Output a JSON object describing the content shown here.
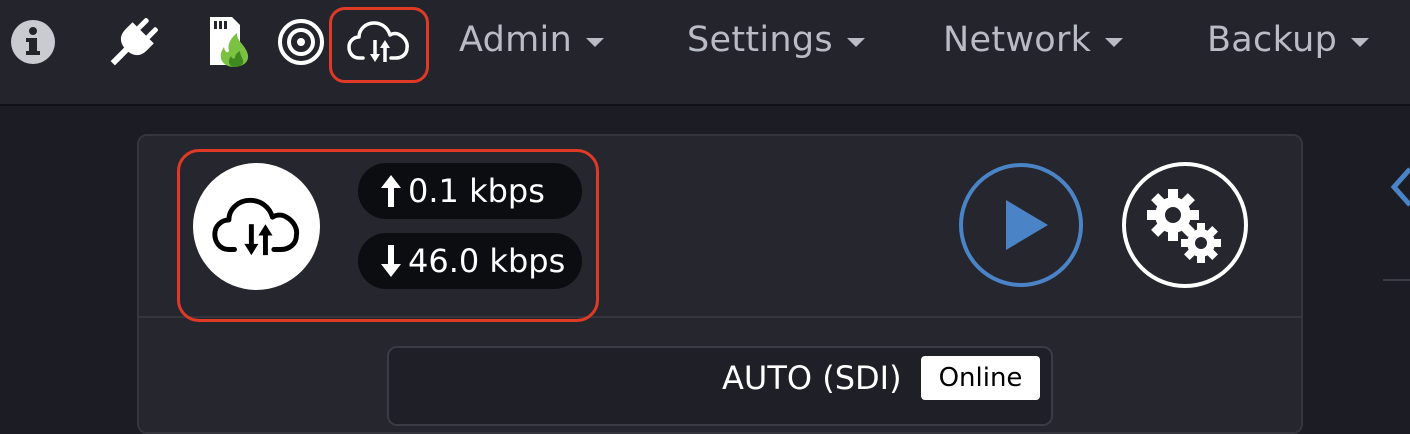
{
  "navbar": {
    "icons": [
      "info-icon",
      "plug-icon",
      "sd-card-fire-icon",
      "target-icon",
      "cloud-transfer-icon"
    ],
    "menus": [
      {
        "label": "Admin"
      },
      {
        "label": "Settings"
      },
      {
        "label": "Network"
      },
      {
        "label": "Backup"
      }
    ]
  },
  "stream": {
    "upload_rate": "0.1 kbps",
    "download_rate": "46.0 kbps",
    "icons": [
      "cloud-transfer-icon",
      "arrow-up-icon",
      "arrow-down-icon",
      "play-icon",
      "gears-icon"
    ]
  },
  "source": {
    "label": "AUTO (SDI)",
    "status": "Online"
  },
  "colors": {
    "highlight": "#e03a26",
    "play_accent": "#4a84c6",
    "background": "#1c1d24",
    "menu_text": "#b9bcc4"
  }
}
